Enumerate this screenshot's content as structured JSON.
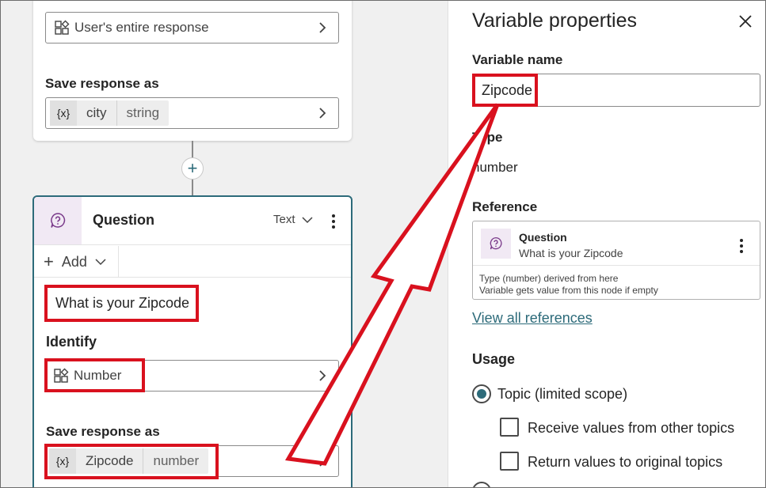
{
  "card1": {
    "identify_value": "User's entire response",
    "save_label": "Save response as",
    "variable": {
      "symbol": "{x}",
      "name": "city",
      "type": "string"
    }
  },
  "question_node": {
    "title": "Question",
    "type_selector": "Text",
    "add_label": "Add",
    "prompt_text": "What is your Zipcode",
    "identify_label": "Identify",
    "identify_value": "Number",
    "save_label": "Save response as",
    "variable": {
      "symbol": "{x}",
      "name": "Zipcode",
      "type": "number"
    }
  },
  "panel": {
    "title": "Variable properties",
    "variable_name_label": "Variable name",
    "variable_name_value": "Zipcode",
    "type_label": "Type",
    "type_value": "number",
    "reference_label": "Reference",
    "reference": {
      "title": "Question",
      "subtitle": "What is your Zipcode",
      "line1": "Type (number) derived from here",
      "line2": "Variable gets value from this node if empty"
    },
    "view_all_references": "View all references",
    "usage_label": "Usage",
    "usage_option_topic": "Topic (limited scope)",
    "receive_values": "Receive values from other topics",
    "return_values": "Return values to original topics"
  },
  "colors": {
    "accent": "#2d6b7a",
    "highlight_red": "#d9111e",
    "question_icon_bg": "#f1e9f4"
  }
}
